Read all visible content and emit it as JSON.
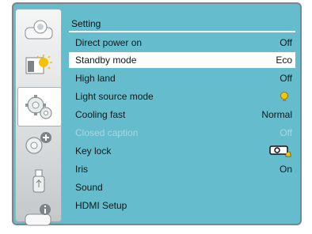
{
  "sidebar": {
    "tabs": [
      {
        "icon": "display-icon"
      },
      {
        "icon": "picture-adjust-icon"
      },
      {
        "icon": "setting-gear-icon",
        "active": true
      },
      {
        "icon": "expanded-gear-icon"
      },
      {
        "icon": "usb-memory-icon"
      },
      {
        "icon": "information-icon"
      }
    ]
  },
  "menu": {
    "title": "Setting",
    "items": [
      {
        "label": "Direct power on",
        "value": "Off"
      },
      {
        "label": "Standby mode",
        "value": "Eco",
        "selected": true
      },
      {
        "label": "High land",
        "value": "Off"
      },
      {
        "label": "Light source mode",
        "value": "",
        "icon": "lamp-icon"
      },
      {
        "label": "Cooling fast",
        "value": "Normal"
      },
      {
        "label": "Closed caption",
        "value": "Off",
        "disabled": true
      },
      {
        "label": "Key lock",
        "value": "",
        "icon": "projector-lock-icon"
      },
      {
        "label": "Iris",
        "value": "On"
      },
      {
        "label": "Sound",
        "value": ""
      },
      {
        "label": "HDMI Setup",
        "value": ""
      }
    ]
  },
  "colors": {
    "panel_bg": "#65bccc",
    "selected_row": "#ffffff",
    "disabled_text": "#a7d8e0",
    "frame_border": "#7f8487"
  }
}
